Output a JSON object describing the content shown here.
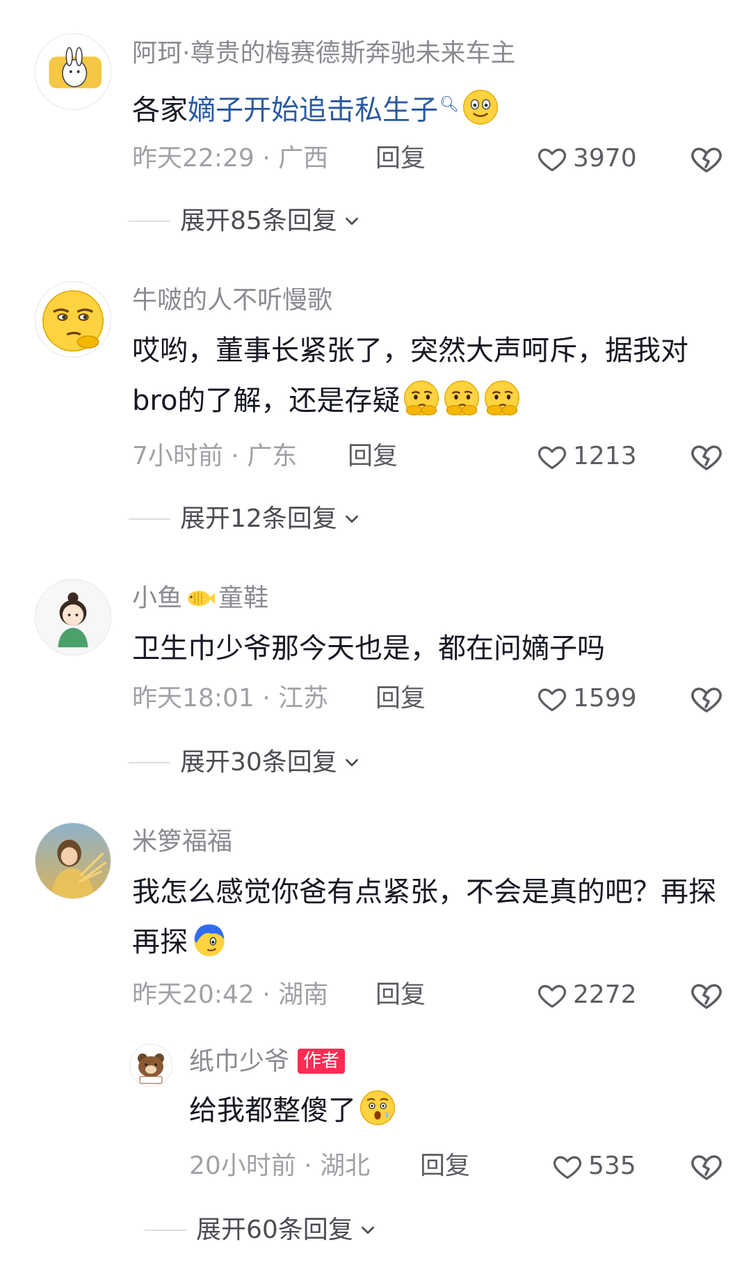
{
  "comments": [
    {
      "username": "阿珂·尊贵的梅赛德斯奔驰未来车主",
      "text_prefix": "各家",
      "text_link": "嫡子开始追击私生子",
      "time": "昨天22:29",
      "location": "广西",
      "reply_label": "回复",
      "likes": "3970",
      "expand_label": "展开85条回复"
    },
    {
      "username": "牛啵的人不听慢歌",
      "text": "哎哟，董事长紧张了，突然大声呵斥，据我对bro的了解，还是存疑",
      "time": "7小时前",
      "location": "广东",
      "reply_label": "回复",
      "likes": "1213",
      "expand_label": "展开12条回复"
    },
    {
      "username_a": "小鱼",
      "username_b": "童鞋",
      "text": "卫生巾少爷那今天也是，都在问嫡子吗",
      "time": "昨天18:01",
      "location": "江苏",
      "reply_label": "回复",
      "likes": "1599",
      "expand_label": "展开30条回复"
    },
    {
      "username": "米箩福福",
      "text": "我怎么感觉你爸有点紧张，不会是真的吧？再探再探",
      "time": "昨天20:42",
      "location": "湖南",
      "reply_label": "回复",
      "likes": "2272",
      "reply": {
        "username": "纸巾少爷",
        "badge": "作者",
        "text": "给我都整傻了",
        "time": "20小时前",
        "location": "湖北",
        "reply_label": "回复",
        "likes": "535"
      },
      "expand_label": "展开60条回复"
    }
  ],
  "separator": " · ",
  "colors": {
    "link": "#2c5aa0",
    "author_badge": "#fe2c55",
    "meta": "#a0a1a6",
    "username": "#8a8b91"
  }
}
